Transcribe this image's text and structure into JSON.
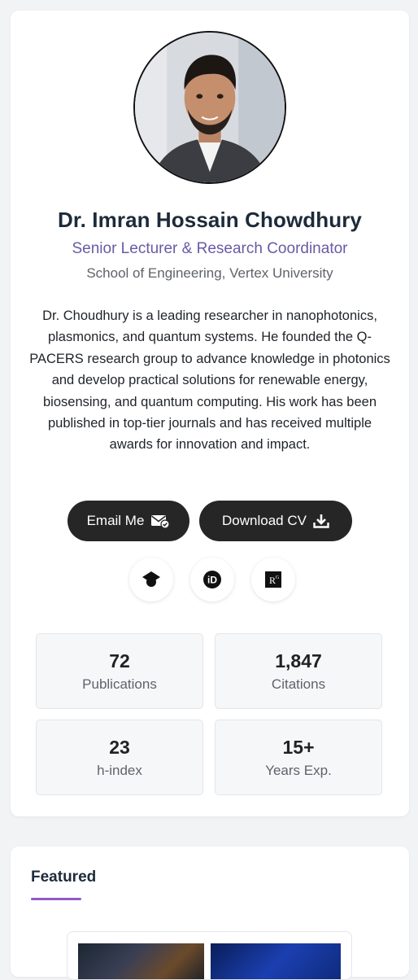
{
  "profile": {
    "name": "Dr. Imran Hossain Chowdhury",
    "role": "Senior Lecturer & Research Coordinator",
    "school": "School of Engineering, Vertex University",
    "bio": "Dr. Choudhury is a leading researcher in nanophotonics, plasmonics, and quantum systems. He founded the Q-PACERS research group to advance knowledge in photonics and develop practical solutions for renewable energy, biosensing, and quantum computing. His work has been published in top-tier journals and has received multiple awards for innovation and impact."
  },
  "actions": {
    "email_label": "Email Me",
    "email_icon": "envelope-check-icon",
    "cv_label": "Download CV",
    "cv_icon": "download-icon"
  },
  "social": [
    {
      "icon": "google-scholar-icon"
    },
    {
      "icon": "orcid-icon",
      "text": "iD"
    },
    {
      "icon": "researchgate-icon",
      "text": "R"
    }
  ],
  "stats": [
    {
      "value": "72",
      "label": "Publications"
    },
    {
      "value": "1,847",
      "label": "Citations"
    },
    {
      "value": "23",
      "label": "h-index"
    },
    {
      "value": "15+",
      "label": "Years Exp."
    }
  ],
  "featured": {
    "title": "Featured"
  },
  "colors": {
    "accent_purple": "#6a5aa5",
    "underline": "#8e5bc5",
    "button_dark": "#262626"
  }
}
